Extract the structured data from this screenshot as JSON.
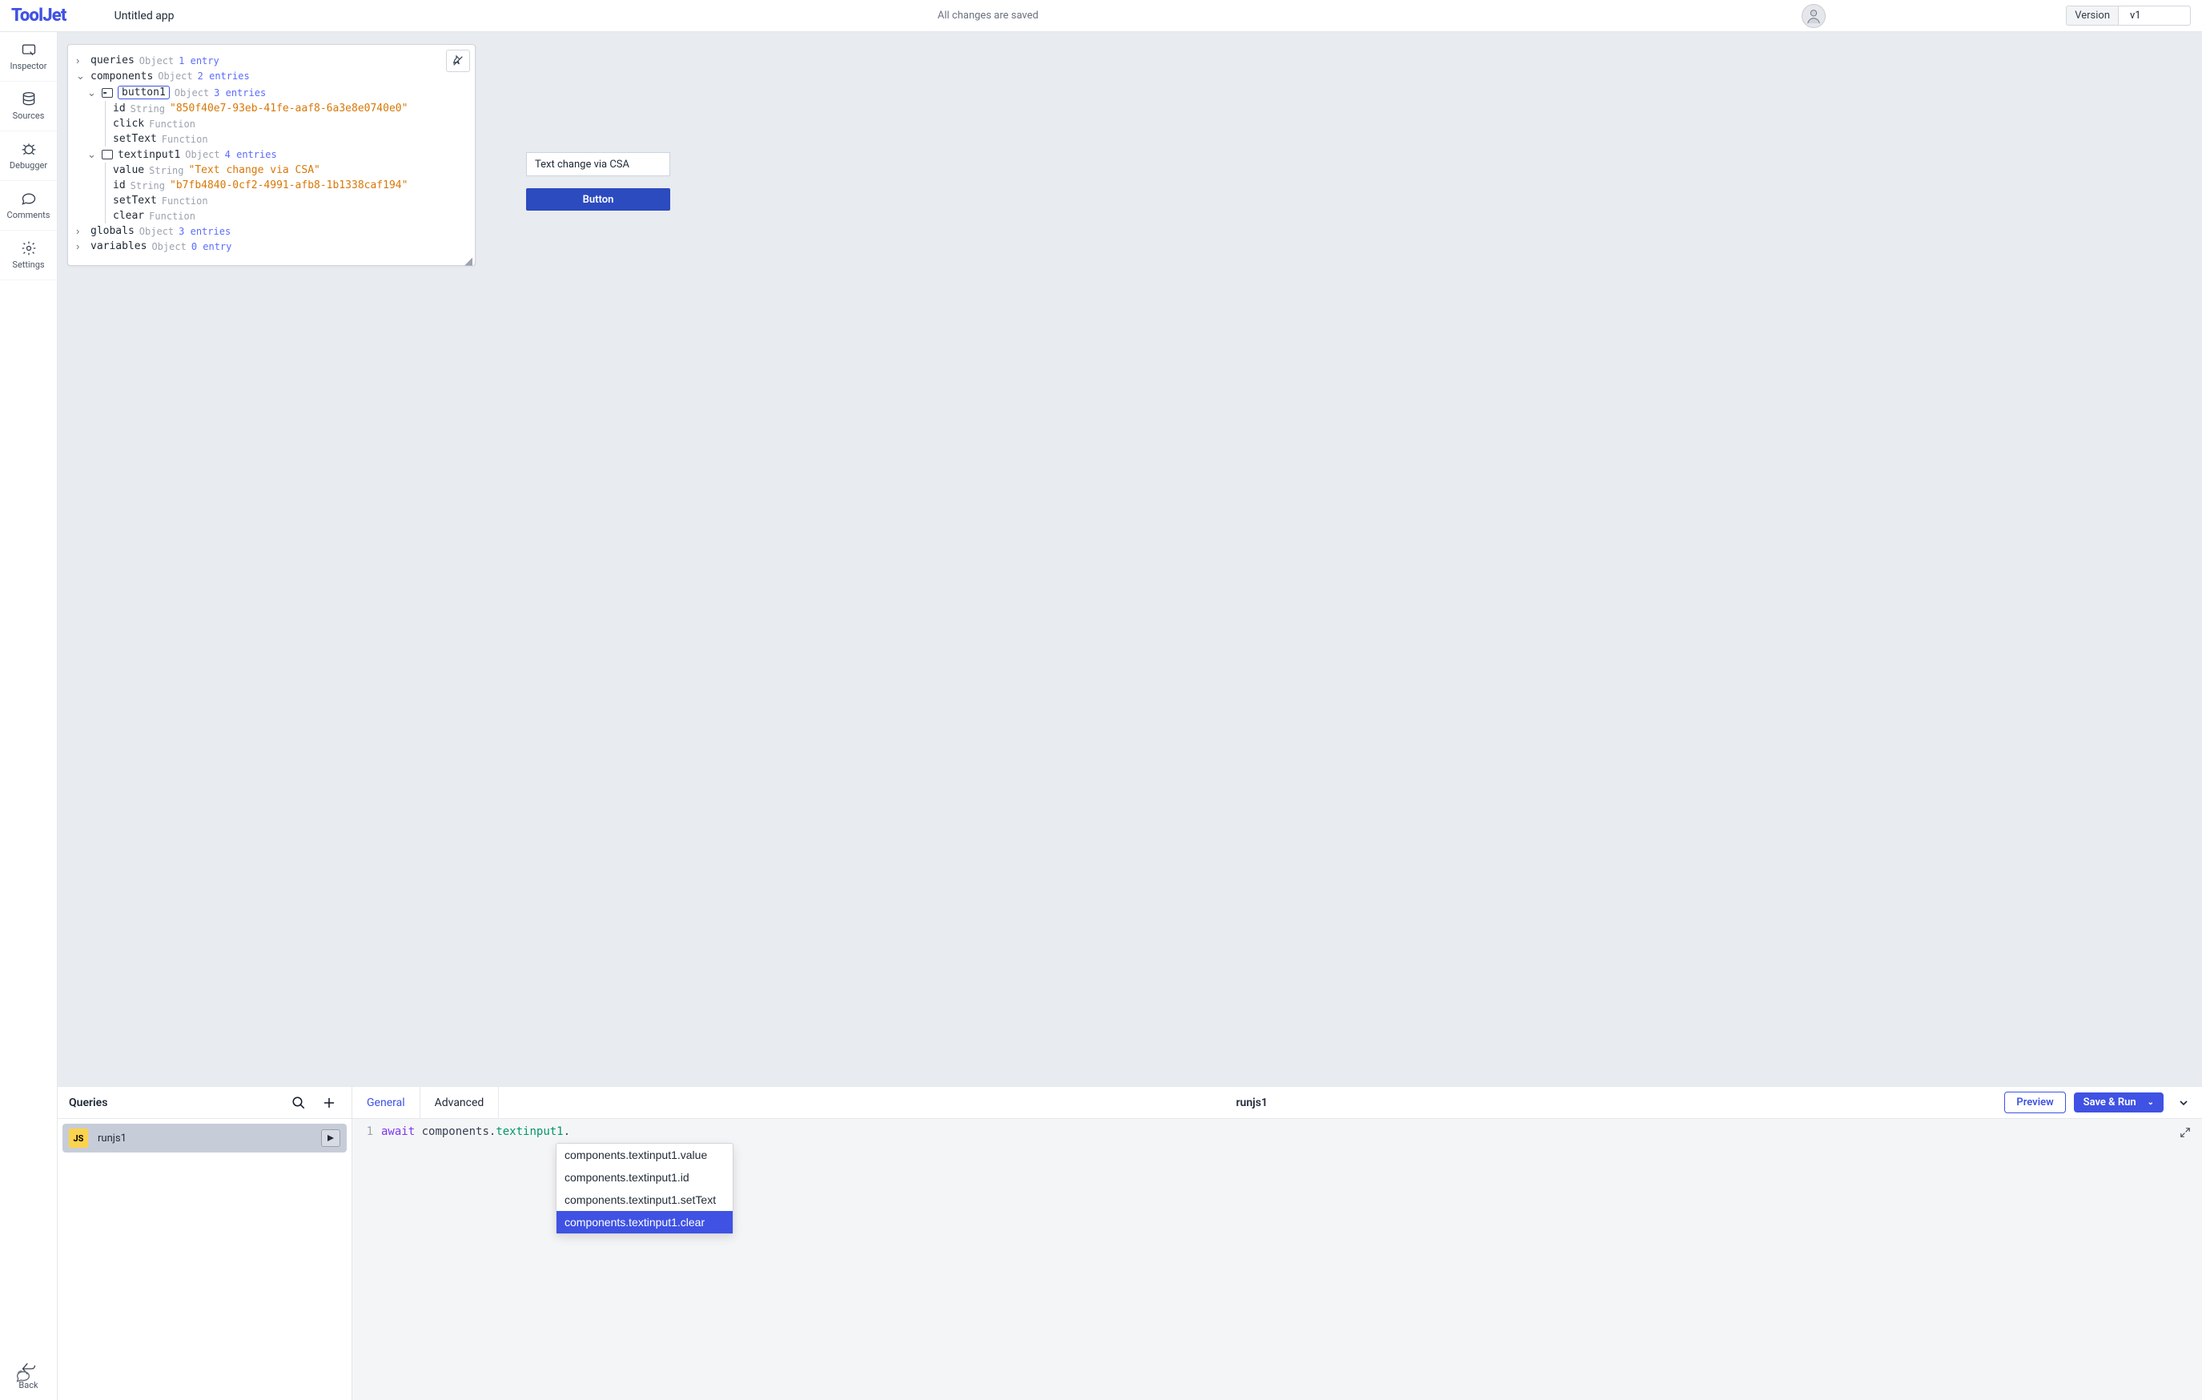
{
  "topbar": {
    "logo": "ToolJet",
    "app_name": "Untitled app",
    "saved_status": "All changes are saved",
    "version_label": "Version",
    "version_value": "v1"
  },
  "leftbar": {
    "inspector": "Inspector",
    "sources": "Sources",
    "debugger": "Debugger",
    "comments": "Comments",
    "settings": "Settings",
    "back": "Back"
  },
  "inspector": {
    "queries": {
      "key": "queries",
      "type": "Object",
      "entries": "1 entry"
    },
    "components": {
      "key": "components",
      "type": "Object",
      "entries": "2 entries"
    },
    "button1": {
      "key": "button1",
      "type": "Object",
      "entries": "3 entries",
      "id": {
        "key": "id",
        "type": "String",
        "value": "\"850f40e7-93eb-41fe-aaf8-6a3e8e0740e0\""
      },
      "click": {
        "key": "click",
        "type": "Function"
      },
      "setText": {
        "key": "setText",
        "type": "Function"
      }
    },
    "textinput1": {
      "key": "textinput1",
      "type": "Object",
      "entries": "4 entries",
      "value": {
        "key": "value",
        "type": "String",
        "value": "\"Text change via CSA\""
      },
      "id": {
        "key": "id",
        "type": "String",
        "value": "\"b7fb4840-0cf2-4991-afb8-1b1338caf194\""
      },
      "setText": {
        "key": "setText",
        "type": "Function"
      },
      "clear": {
        "key": "clear",
        "type": "Function"
      }
    },
    "globals": {
      "key": "globals",
      "type": "Object",
      "entries": "3 entries"
    },
    "variables": {
      "key": "variables",
      "type": "Object",
      "entries": "0 entry"
    }
  },
  "canvas": {
    "textinput_value": "Text change via CSA",
    "button_label": "Button"
  },
  "queries_panel": {
    "title": "Queries",
    "item1": "runjs1",
    "js_badge": "JS"
  },
  "editor": {
    "tab_general": "General",
    "tab_advanced": "Advanced",
    "query_name": "runjs1",
    "preview_btn": "Preview",
    "run_btn": "Save & Run",
    "line_no": "1",
    "tok_await": "await",
    "tok_components": "components",
    "tok_textinput1": "textinput1",
    "dot": "."
  },
  "autocomplete": {
    "opt1": "components.textinput1.value",
    "opt2": "components.textinput1.id",
    "opt3": "components.textinput1.setText",
    "opt4": "components.textinput1.clear"
  }
}
